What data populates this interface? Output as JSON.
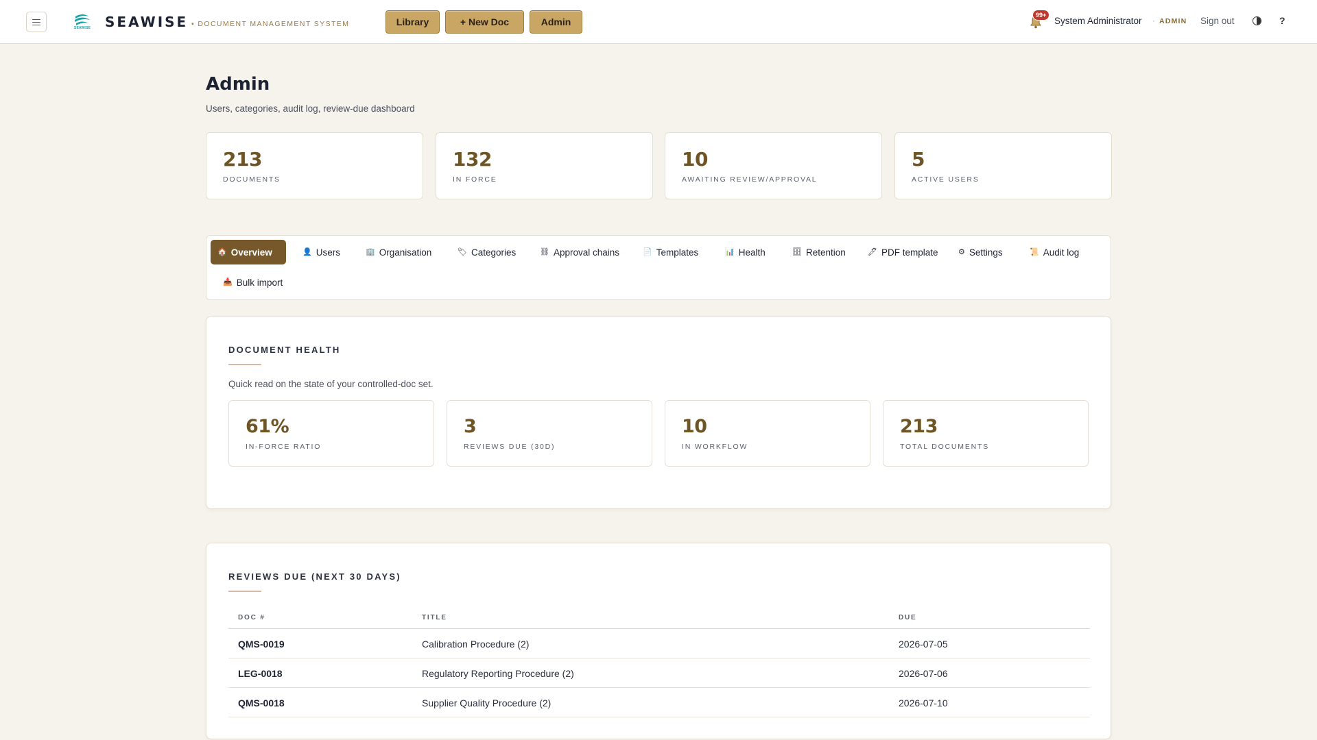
{
  "header": {
    "brand": "SEAWISE",
    "brand_mini": "SEAWISE",
    "subtitle": "• DOCUMENT MANAGEMENT SYSTEM",
    "nav": {
      "library": "Library",
      "new_doc": "+  New Doc",
      "admin": "Admin"
    },
    "notification_badge": "99+",
    "user_name": "System Administrator",
    "separator": "·",
    "user_role": "ADMIN",
    "sign_out": "Sign out",
    "help": "?"
  },
  "page": {
    "title": "Admin",
    "subtitle": "Users, categories, audit log, review-due dashboard"
  },
  "stats": [
    {
      "value": "213",
      "label": "DOCUMENTS"
    },
    {
      "value": "132",
      "label": "IN FORCE"
    },
    {
      "value": "10",
      "label": "AWAITING REVIEW/APPROVAL"
    },
    {
      "value": "5",
      "label": "ACTIVE USERS"
    }
  ],
  "tabs": [
    {
      "icon": "🏠",
      "label": "Overview",
      "active": true
    },
    {
      "icon": "👤",
      "label": "Users"
    },
    {
      "icon": "🏢",
      "label": "Organisation"
    },
    {
      "icon": "🏷",
      "label": "Categories"
    },
    {
      "icon": "⛓",
      "label": "Approval chains"
    },
    {
      "icon": "📄",
      "label": "Templates"
    },
    {
      "icon": "📊",
      "label": "Health"
    },
    {
      "icon": "🗄",
      "label": "Retention"
    },
    {
      "icon": "🖊",
      "label": "PDF template"
    },
    {
      "icon": "⚙",
      "label": "Settings"
    },
    {
      "icon": "📜",
      "label": "Audit log"
    },
    {
      "icon": "📥",
      "label": "Bulk import"
    }
  ],
  "health": {
    "title": "DOCUMENT HEALTH",
    "description": "Quick read on the state of your controlled-doc set.",
    "cards": [
      {
        "value": "61%",
        "label": "IN-FORCE RATIO"
      },
      {
        "value": "3",
        "label": "REVIEWS DUE (30D)"
      },
      {
        "value": "10",
        "label": "IN WORKFLOW"
      },
      {
        "value": "213",
        "label": "TOTAL DOCUMENTS"
      }
    ]
  },
  "reviews": {
    "title": "REVIEWS DUE (NEXT 30 DAYS)",
    "columns": [
      "DOC #",
      "TITLE",
      "DUE"
    ],
    "rows": [
      {
        "doc": "QMS-0019",
        "title": "Calibration Procedure (2)",
        "due": "2026-07-05"
      },
      {
        "doc": "LEG-0018",
        "title": "Regulatory Reporting Procedure (2)",
        "due": "2026-07-06"
      },
      {
        "doc": "QMS-0018",
        "title": "Supplier Quality Procedure (2)",
        "due": "2026-07-10"
      }
    ]
  },
  "colors": {
    "accent_gold": "#c9a664",
    "accent_brown": "#76582a",
    "stat_number": "#6e5526",
    "badge_red": "#c0392b",
    "logo_teal": "#1aa2a5"
  }
}
